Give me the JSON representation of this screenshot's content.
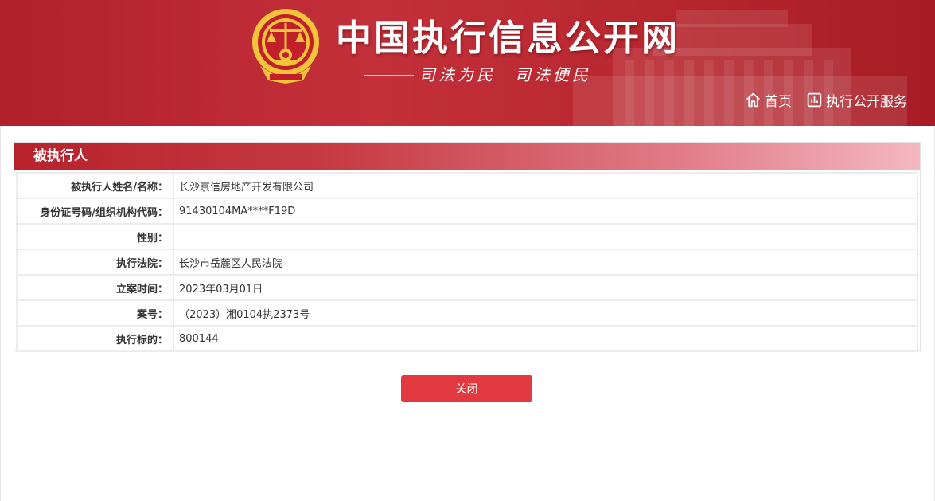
{
  "header": {
    "site_title": "中国执行信息公开网",
    "slogan_1": "司法为民",
    "slogan_2": "司法便民",
    "nav": [
      {
        "label": "首页",
        "icon": "home-icon"
      },
      {
        "label": "执行公开服务",
        "icon": "chart-icon"
      }
    ]
  },
  "panel": {
    "title": "被执行人",
    "rows": [
      {
        "label": "被执行人姓名/名称：",
        "value": "长沙京信房地产开发有限公司"
      },
      {
        "label": "身份证号码/组织机构代码：",
        "value": "91430104MA****F19D"
      },
      {
        "label": "性别：",
        "value": ""
      },
      {
        "label": "执行法院：",
        "value": "长沙市岳麓区人民法院"
      },
      {
        "label": "立案时间：",
        "value": "2023年03月01日"
      },
      {
        "label": "案号：",
        "value": "（2023）湘0104执2373号"
      },
      {
        "label": "执行标的：",
        "value": "800144"
      }
    ]
  },
  "actions": {
    "close_label": "关闭"
  },
  "colors": {
    "brand_red": "#b8222c",
    "button_red": "#e2383f",
    "emblem_gold": "#f3c43a"
  }
}
